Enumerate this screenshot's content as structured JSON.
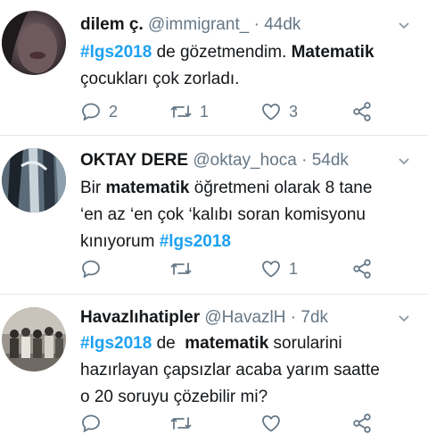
{
  "tweets": [
    {
      "name": "dilem ç.",
      "handle": "@immigrant_",
      "sep": "·",
      "time": "44dk",
      "text": {
        "hashtag": "#lgs2018",
        "part1": " de gözetmendim. ",
        "kw": "Matematik",
        "part2": "çocukları çok zorladı."
      },
      "replies": "2",
      "retweets": "1",
      "likes": "3"
    },
    {
      "name": "OKTAY DERE",
      "handle": "@oktay_hoca",
      "sep": "·",
      "time": "54dk",
      "text": {
        "part1": "Bir ",
        "kw": "matematik",
        "part2": " öğretmeni olarak 8 tane",
        "line2": "‘en az ‘en çok ‘kalıbı soran komisyonu",
        "line3": "kınıyorum ",
        "hashtag": "#lgs2018"
      },
      "replies": "",
      "retweets": "",
      "likes": "1"
    },
    {
      "name": "Havazlıhatipler",
      "handle": "@HavazlH",
      "sep": "·",
      "time": "7dk",
      "text": {
        "hashtag": "#lgs2018",
        "part1": " de  ",
        "kw": "matematik",
        "part2": " sorularini",
        "line2": "hazırlayan çapsızlar acaba yarım saatte",
        "line3": "o 20 soruyu çözebilir mi?"
      }
    }
  ],
  "icons": {
    "reply": "reply-icon",
    "retweet": "retweet-icon",
    "like": "heart-icon",
    "share": "share-icon",
    "more": "chevron-down-icon"
  },
  "colors": {
    "link": "#1da1f2",
    "muted": "#657786",
    "divider": "#e1e8ed"
  }
}
